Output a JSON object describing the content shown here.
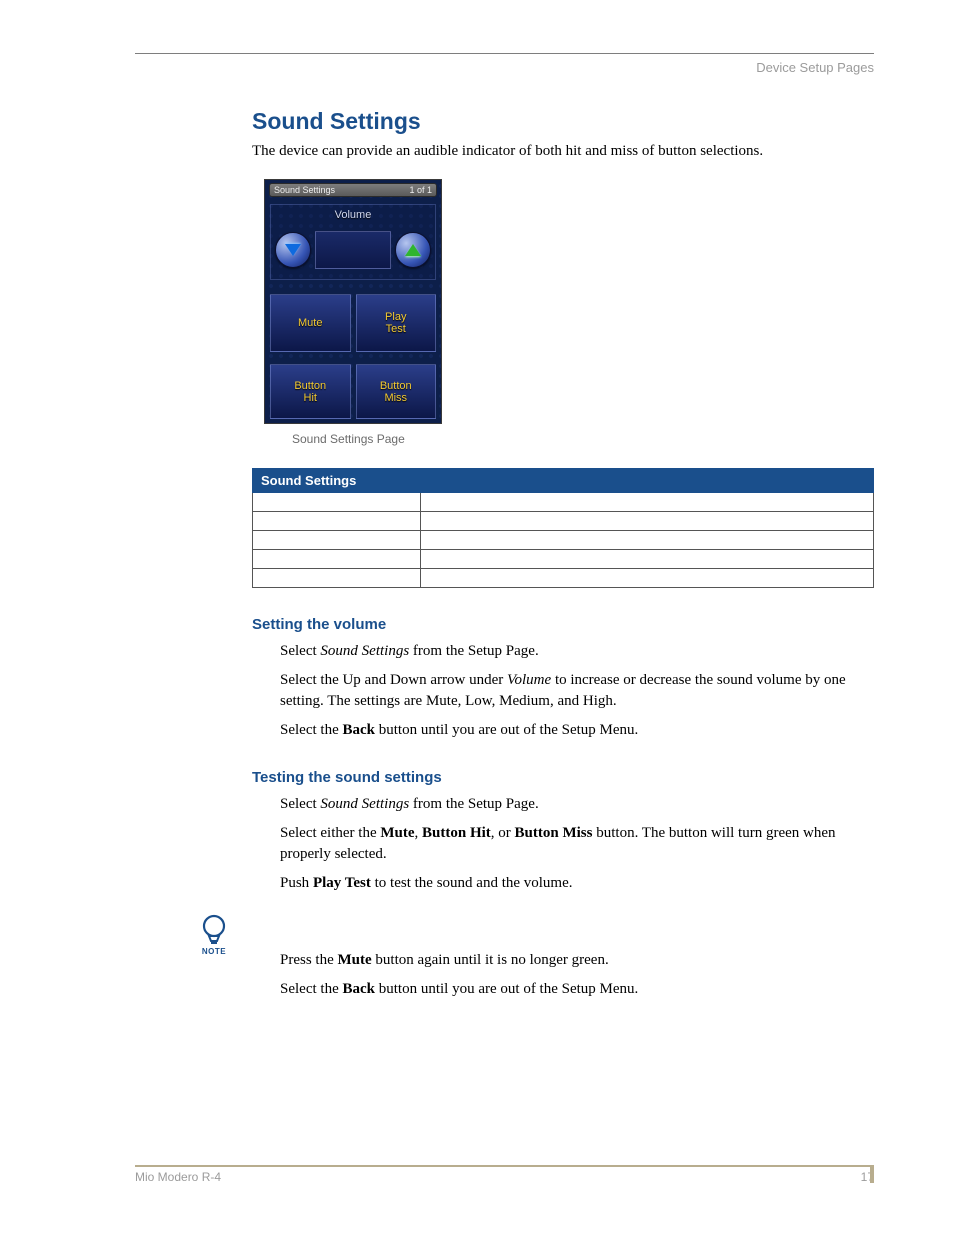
{
  "header": {
    "right": "Device Setup Pages"
  },
  "title": "Sound Settings",
  "intro": "The device can provide an audible indicator of both hit and miss of button selections.",
  "device": {
    "titlebar_left": "Sound Settings",
    "titlebar_right": "1 of 1",
    "volume_label": "Volume",
    "buttons": {
      "mute": "Mute",
      "play_test": "Play\nTest",
      "button_hit": "Button\nHit",
      "button_miss": "Button\nMiss"
    }
  },
  "caption": "Sound Settings Page",
  "table": {
    "header": "Sound Settings",
    "rows": [
      {
        "c1": "",
        "c2": ""
      },
      {
        "c1": "",
        "c2": ""
      },
      {
        "c1": "",
        "c2": ""
      },
      {
        "c1": "",
        "c2": ""
      },
      {
        "c1": "",
        "c2": ""
      }
    ]
  },
  "sub1": {
    "heading": "Setting the volume",
    "step1_a": "Select ",
    "step1_i": "Sound Settings",
    "step1_b": " from the Setup Page.",
    "step2_a": "Select the Up and Down arrow under ",
    "step2_i": "Volume",
    "step2_b": " to increase or decrease the sound volume by one setting. The settings are Mute, Low, Medium, and High.",
    "step3_a": "Select the ",
    "step3_s": "Back",
    "step3_b": " button until you are out of the Setup Menu."
  },
  "sub2": {
    "heading": "Testing the sound settings",
    "step1_a": "Select ",
    "step1_i": "Sound Settings",
    "step1_b": " from the Setup Page.",
    "step2_a": "Select either the ",
    "step2_s1": "Mute",
    "step2_m1": ", ",
    "step2_s2": "Button Hit",
    "step2_m2": ", or ",
    "step2_s3": "Button Miss",
    "step2_b": " button. The button will turn green when properly selected.",
    "step3_a": "Push ",
    "step3_s": "Play Test",
    "step3_b": " to test the sound and the volume.",
    "note_label": "NOTE",
    "step4_a": "Press the ",
    "step4_s": "Mute",
    "step4_b": " button again until it is no longer green.",
    "step5_a": "Select the ",
    "step5_s": "Back",
    "step5_b": " button until you are out of the Setup Menu."
  },
  "footer": {
    "left": "Mio Modero R-4",
    "right": "17"
  }
}
